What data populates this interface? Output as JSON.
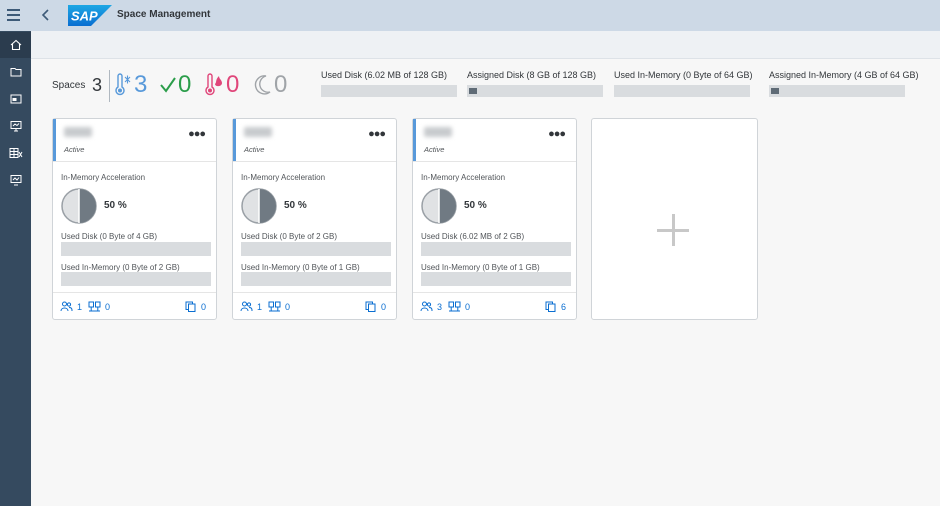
{
  "app": {
    "title": "Space Management"
  },
  "summary": {
    "spaces_label": "Spaces",
    "spaces_count": "3",
    "stats": [
      {
        "icon": "cold-thermometer-icon",
        "value": "3",
        "color": "#5899da"
      },
      {
        "icon": "checkmark-icon",
        "value": "0",
        "color": "#2b9d4a"
      },
      {
        "icon": "hot-thermometer-icon",
        "value": "0",
        "color": "#e0467a"
      },
      {
        "icon": "moon-icon",
        "value": "0",
        "color": "#a0a4a8"
      }
    ],
    "metrics": [
      {
        "label": "Used Disk (6.02 MB of 128 GB)",
        "fill": 0.0
      },
      {
        "label": "Assigned Disk (8 GB of 128 GB)",
        "fill": 0.0625
      },
      {
        "label": "Used In-Memory (0 Byte of 64 GB)",
        "fill": 0.0
      },
      {
        "label": "Assigned In-Memory (4 GB of 64 GB)",
        "fill": 0.0625
      }
    ]
  },
  "cards": [
    {
      "status": "Active",
      "accel_label": "In-Memory Acceleration",
      "accel_pct": "50 %",
      "disk_label": "Used Disk (0 Byte of 4 GB)",
      "mem_label": "Used In-Memory (0 Byte of 2 GB)",
      "users": "1",
      "connections": "0",
      "objects": "0"
    },
    {
      "status": "Active",
      "accel_label": "In-Memory Acceleration",
      "accel_pct": "50 %",
      "disk_label": "Used Disk (0 Byte of 2 GB)",
      "mem_label": "Used In-Memory (0 Byte of 1 GB)",
      "users": "1",
      "connections": "0",
      "objects": "0"
    },
    {
      "status": "Active",
      "accel_label": "In-Memory Acceleration",
      "accel_pct": "50 %",
      "disk_label": "Used Disk (6.02 MB of 2 GB)",
      "mem_label": "Used In-Memory (0 Byte of 1 GB)",
      "users": "3",
      "connections": "0",
      "objects": "6"
    }
  ],
  "colors": {
    "shell": "#cdd9e6",
    "sidenav": "#354a5f",
    "accent": "#5899da",
    "link": "#0a6ed1"
  }
}
